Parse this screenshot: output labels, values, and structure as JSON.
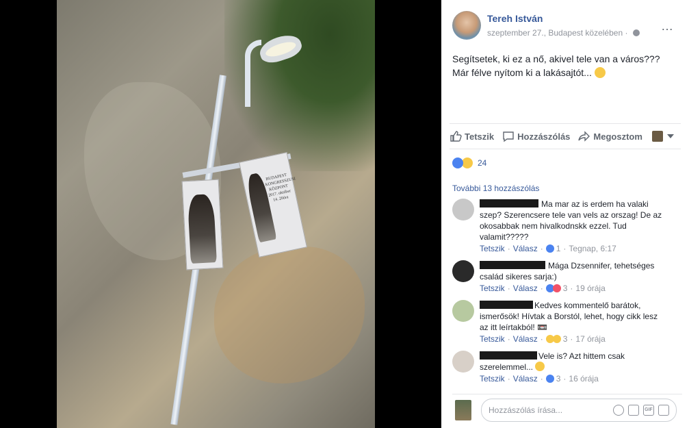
{
  "photo": {
    "banner_left_text": "",
    "banner_right_text": "BUDAPEST KONGRESSZUSI KÖZPONT 2017. október 14. 20óra"
  },
  "post": {
    "author": "Tereh István",
    "meta": "szeptember 27., Budapest közelében · ",
    "more_icon": "…",
    "text_line1": "Segítsetek, ki ez a nő, akivel tele van a város???",
    "text_line2": "Már félve nyítom ki a lakásajtót... "
  },
  "actions": {
    "like": "Tetszik",
    "comment": "Hozzászólás",
    "share": "Megosztom"
  },
  "reactions": {
    "count": "24"
  },
  "comments": {
    "more": "További 13 hozzászólás",
    "items": [
      {
        "text": "Ma mar az is erdem ha valaki szep? Szerencsere tele van vels az orszag! De az okosabbak nem hivalkodnskk ezzel. Tud valamit?????",
        "like": "Tetszik",
        "reply": "Válasz",
        "count": "1",
        "time": "Tegnap, 6:17"
      },
      {
        "text": "Mága Dzsennifer, tehetséges család sikeres sarja:)",
        "like": "Tetszik",
        "reply": "Válasz",
        "count": "3",
        "time": "19 órája"
      },
      {
        "text": "Kedves kommentelő barátok, ismerősök! Hívtak a Borstól, lehet, hogy cikk lesz az itt leírtakból! 📼",
        "like": "Tetszik",
        "reply": "Válasz",
        "count": "3",
        "time": "17 órája"
      },
      {
        "text": "Vele is? Azt hittem csak szerelemmel... ",
        "like": "Tetszik",
        "reply": "Válasz",
        "count": "3",
        "time": "16 órája"
      }
    ]
  },
  "composer": {
    "placeholder": "Hozzászólás írása..."
  }
}
